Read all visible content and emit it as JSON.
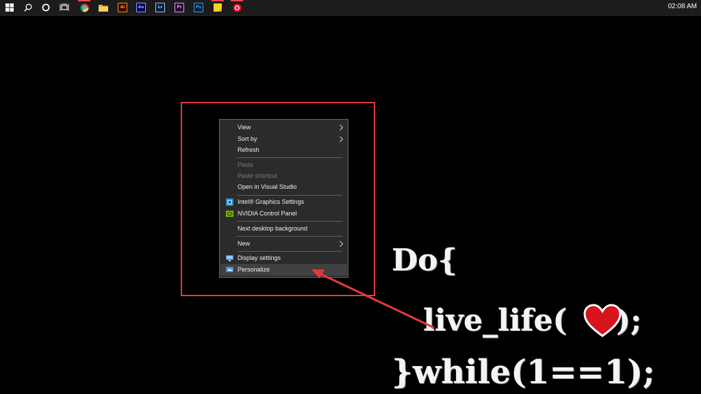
{
  "taskbar": {
    "apps": [
      {
        "name": "Illustrator",
        "abbr": "Ai",
        "color": "#ff9a00",
        "bg": "#330000"
      },
      {
        "name": "After Effects",
        "abbr": "Ae",
        "color": "#9999ff",
        "bg": "#00005b"
      },
      {
        "name": "Lightroom",
        "abbr": "Lr",
        "color": "#a4c8ff",
        "bg": "#001e36"
      },
      {
        "name": "Premiere",
        "abbr": "Pr",
        "color": "#e0a0ff",
        "bg": "#2a0033"
      },
      {
        "name": "Photoshop",
        "abbr": "Ps",
        "color": "#31a8ff",
        "bg": "#001e36"
      }
    ],
    "clock": "02:08 AM"
  },
  "context_menu": {
    "items": [
      {
        "label": "View",
        "disabled": false,
        "submenu": true
      },
      {
        "label": "Sort by",
        "disabled": false,
        "submenu": true
      },
      {
        "label": "Refresh",
        "disabled": false,
        "submenu": false
      },
      {
        "label": "Paste",
        "disabled": true,
        "submenu": false
      },
      {
        "label": "Paste shortcut",
        "disabled": true,
        "submenu": false
      },
      {
        "label": "Open in Visual Studio",
        "disabled": false,
        "submenu": false
      },
      {
        "label": "Intel® Graphics Settings",
        "disabled": false,
        "submenu": false,
        "icon": "intel-graphics-icon"
      },
      {
        "label": "NVIDIA Control Panel",
        "disabled": false,
        "submenu": false,
        "icon": "nvidia-icon"
      },
      {
        "label": "Next desktop background",
        "disabled": false,
        "submenu": false
      },
      {
        "label": "New",
        "disabled": false,
        "submenu": true
      },
      {
        "label": "Display settings",
        "disabled": false,
        "submenu": false,
        "icon": "display-settings-icon"
      },
      {
        "label": "Personalize",
        "disabled": false,
        "submenu": false,
        "icon": "personalize-icon",
        "highlighted": true
      }
    ]
  },
  "wallpaper": {
    "line1": "Do{",
    "line2_before": "live_life(",
    "line2_after": ");",
    "line3": "}while(1==1);"
  },
  "colors": {
    "highlight": "#e23b3b",
    "menu_bg": "#2b2b2b",
    "taskbar_bg": "#1c1c1c"
  }
}
